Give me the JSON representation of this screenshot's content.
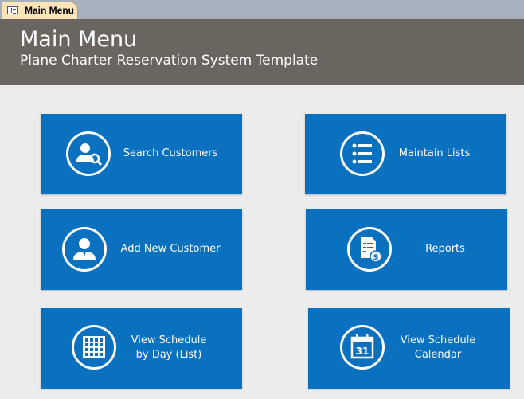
{
  "tab": {
    "label": "Main Menu",
    "icon": "form-icon"
  },
  "header": {
    "title": "Main Menu",
    "subtitle": "Plane Charter Reservation System Template",
    "background": "#6b6560"
  },
  "buttons": {
    "search_customers": {
      "label": "Search Customers",
      "icon": "search-customer-icon"
    },
    "maintain_lists": {
      "label": "Maintain Lists",
      "icon": "list-icon"
    },
    "add_new_customer": {
      "label": "Add New Customer",
      "icon": "user-icon"
    },
    "reports": {
      "label": "Reports",
      "icon": "report-dollar-icon"
    },
    "view_schedule_list": {
      "label": "View Schedule\nby Day (List)",
      "icon": "calendar-grid-icon"
    },
    "view_schedule_calendar": {
      "label": "View Schedule\nCalendar",
      "icon": "calendar-31-icon"
    }
  },
  "colors": {
    "button": "#0a70c0",
    "background": "#ececec",
    "tab": "#fbe4b8"
  }
}
